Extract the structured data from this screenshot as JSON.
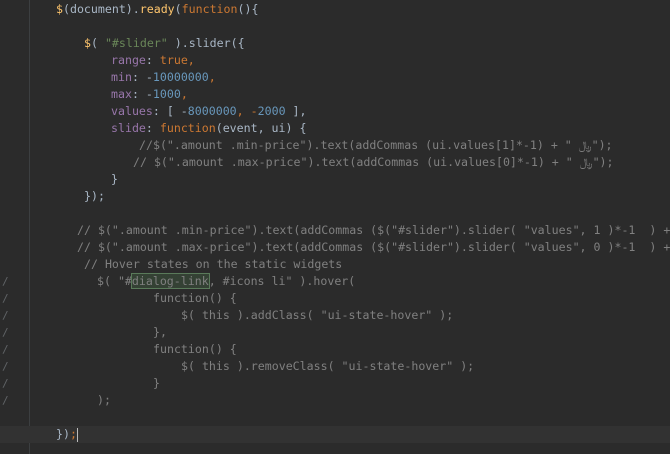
{
  "theme": {
    "background": "#2b2b2b",
    "keyword": "#cc7832",
    "string": "#6a8759",
    "number": "#6897bb",
    "property": "#9876aa",
    "function": "#ffc66d",
    "comment": "#808080",
    "text": "#a9b7c6"
  },
  "gutter": {
    "fold_mark": "/"
  },
  "code": {
    "l1_a": "$",
    "l1_b": "(document).",
    "l1_c": "ready",
    "l1_d": "(",
    "l1_e": "function",
    "l1_f": "(){",
    "l3_a": "$",
    "l3_b": "( ",
    "l3_c": "\"#slider\"",
    "l3_d": " ).slider({",
    "l4_a": "range",
    "l4_b": ": ",
    "l4_c": "true",
    "l4_d": ",",
    "l5_a": "min",
    "l5_b": ": -",
    "l5_c": "10000000",
    "l5_d": ",",
    "l6_a": "max",
    "l6_b": ": -",
    "l6_c": "1000",
    "l6_d": ",",
    "l7_a": "values",
    "l7_b": ": [ -",
    "l7_c": "8000000",
    "l7_d": ", -",
    "l7_e": "2000",
    "l7_f": " ],",
    "l8_a": "slide",
    "l8_b": ": ",
    "l8_c": "function",
    "l8_d": "(event, ui) {",
    "l9": "//$(\".amount .min-price\").text(addCommas (ui.values[1]*-1) + \" ﷼\");",
    "l10": "// $(\".amount .max-price\").text(addCommas (ui.values[0]*-1) + \" ﷼\");",
    "l11": "}",
    "l12": "});",
    "l14": "// $(\".amount .min-price\").text(addCommas ($(\"#slider\").slider( \"values\", 1 )*-1  ) +",
    "l15": "// $(\".amount .max-price\").text(addCommas ($(\"#slider\").slider( \"values\", 0 )*-1  ) +",
    "l16": "// Hover states on the static widgets",
    "l17_a": "$( \"#",
    "l17_b": "dialog-link",
    "l17_c": ", #icons li\" ).hover(",
    "l18": "function() {",
    "l19": "$( this ).addClass( \"ui-state-hover\" );",
    "l20": "},",
    "l21": "function() {",
    "l22": "$( this ).removeClass( \"ui-state-hover\" );",
    "l23": "}",
    "l24": ");",
    "l26_a": "})",
    "l26_b": ";"
  }
}
